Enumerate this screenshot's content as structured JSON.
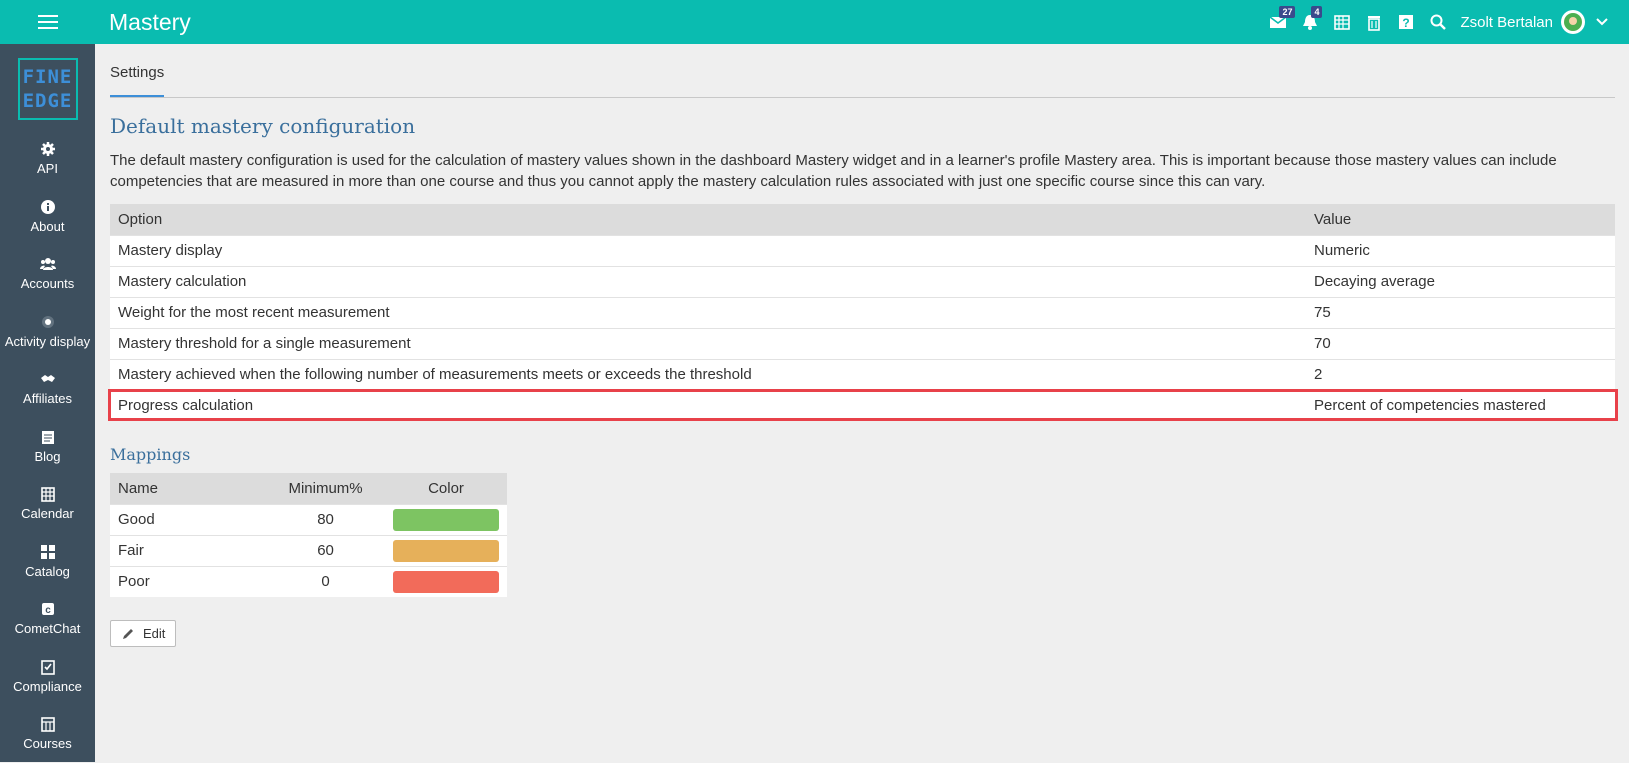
{
  "header": {
    "title": "Mastery",
    "mail_badge": "27",
    "notif_badge": "4",
    "user_name": "Zsolt Bertalan"
  },
  "sidebar": {
    "logo_line1": "FINE",
    "logo_line2": "EDGE",
    "items": [
      {
        "label": "API",
        "icon": "gear-icon"
      },
      {
        "label": "About",
        "icon": "info-icon"
      },
      {
        "label": "Accounts",
        "icon": "users-icon"
      },
      {
        "label": "Activity display",
        "icon": "dot-icon"
      },
      {
        "label": "Affiliates",
        "icon": "handshake-icon"
      },
      {
        "label": "Blog",
        "icon": "blog-icon"
      },
      {
        "label": "Calendar",
        "icon": "calendar-icon"
      },
      {
        "label": "Catalog",
        "icon": "grid-icon"
      },
      {
        "label": "CometChat",
        "icon": "chat-icon"
      },
      {
        "label": "Compliance",
        "icon": "clipboard-icon"
      },
      {
        "label": "Courses",
        "icon": "courses-icon"
      }
    ]
  },
  "tabs": {
    "settings": "Settings"
  },
  "config": {
    "title": "Default mastery configuration",
    "description": "The default mastery configuration is used for the calculation of mastery values shown in the dashboard Mastery widget and in a learner's profile Mastery area. This is important because those mastery values can include competencies that are measured in more than one course and thus you cannot apply the mastery calculation rules associated with just one specific course since this can vary.",
    "headers": {
      "option": "Option",
      "value": "Value"
    },
    "rows": [
      {
        "option": "Mastery display",
        "value": "Numeric"
      },
      {
        "option": "Mastery calculation",
        "value": "Decaying average"
      },
      {
        "option": "Weight for the most recent measurement",
        "value": "75"
      },
      {
        "option": "Mastery threshold for a single measurement",
        "value": "70"
      },
      {
        "option": "Mastery achieved when the following number of measurements meets or exceeds the threshold",
        "value": "2"
      },
      {
        "option": "Progress calculation",
        "value": "Percent of competencies mastered"
      }
    ]
  },
  "mappings": {
    "title": "Mappings",
    "headers": {
      "name": "Name",
      "minimum": "Minimum%",
      "color": "Color"
    },
    "rows": [
      {
        "name": "Good",
        "minimum": "80",
        "color": "#7dc462"
      },
      {
        "name": "Fair",
        "minimum": "60",
        "color": "#e6b05a"
      },
      {
        "name": "Poor",
        "minimum": "0",
        "color": "#f26b5a"
      }
    ]
  },
  "edit_label": "Edit",
  "colors": {
    "topbar": "#0abcb0",
    "sidebar": "#3d4f5e",
    "highlight": "#e8414a",
    "title": "#3a6f9c"
  }
}
